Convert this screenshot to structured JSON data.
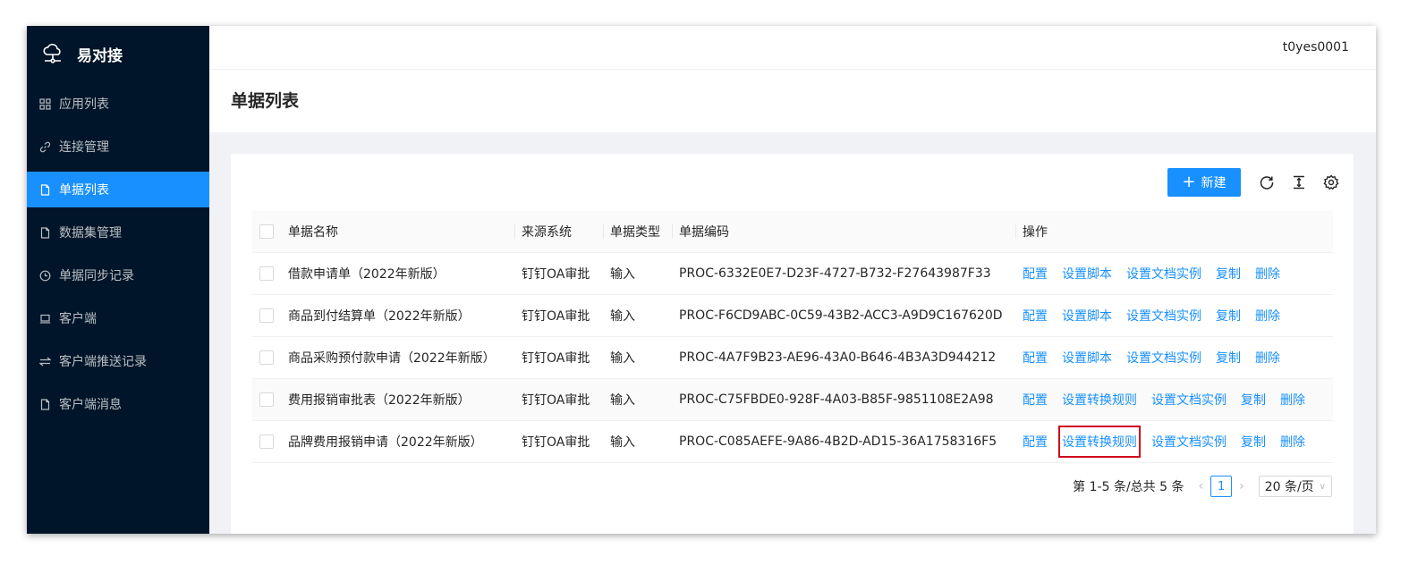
{
  "app": {
    "name": "易对接"
  },
  "user": {
    "name": "t0yes0001"
  },
  "sidebar": {
    "items": [
      {
        "label": "应用列表",
        "icon": "grid-icon"
      },
      {
        "label": "连接管理",
        "icon": "link-icon"
      },
      {
        "label": "单据列表",
        "icon": "file-icon",
        "active": true
      },
      {
        "label": "数据集管理",
        "icon": "file-icon"
      },
      {
        "label": "单据同步记录",
        "icon": "clock-icon"
      },
      {
        "label": "客户端",
        "icon": "laptop-icon"
      },
      {
        "label": "客户端推送记录",
        "icon": "swap-icon"
      },
      {
        "label": "客户端消息",
        "icon": "file-icon"
      }
    ]
  },
  "page": {
    "title": "单据列表"
  },
  "toolbar": {
    "new_label": "新建"
  },
  "table": {
    "columns": [
      "单据名称",
      "来源系统",
      "单据类型",
      "单据编码",
      "操作"
    ],
    "rows": [
      {
        "name": "借款申请单（2022年新版）",
        "source": "钉钉OA审批",
        "type": "输入",
        "code": "PROC-6332E0E7-D23F-4727-B732-F27643987F33",
        "actions": [
          "配置",
          "设置脚本",
          "设置文档实例",
          "复制",
          "删除"
        ]
      },
      {
        "name": "商品到付结算单（2022年新版）",
        "source": "钉钉OA审批",
        "type": "输入",
        "code": "PROC-F6CD9ABC-0C59-43B2-ACC3-A9D9C167620D",
        "actions": [
          "配置",
          "设置脚本",
          "设置文档实例",
          "复制",
          "删除"
        ]
      },
      {
        "name": "商品采购预付款申请（2022年新版）",
        "source": "钉钉OA审批",
        "type": "输入",
        "code": "PROC-4A7F9B23-AE96-43A0-B646-4B3A3D944212",
        "actions": [
          "配置",
          "设置脚本",
          "设置文档实例",
          "复制",
          "删除"
        ]
      },
      {
        "name": "费用报销审批表（2022年新版）",
        "source": "钉钉OA审批",
        "type": "输入",
        "code": "PROC-C75FBDE0-928F-4A03-B85F-9851108E2A98",
        "actions": [
          "配置",
          "设置转换规则",
          "设置文档实例",
          "复制",
          "删除"
        ]
      },
      {
        "name": "品牌费用报销申请（2022年新版）",
        "source": "钉钉OA审批",
        "type": "输入",
        "code": "PROC-C085AEFE-9A86-4B2D-AD15-36A1758316F5",
        "actions": [
          "配置",
          "设置转换规则",
          "设置文档实例",
          "复制",
          "删除"
        ]
      }
    ]
  },
  "pagination": {
    "summary": "第 1-5 条/总共 5 条",
    "current_page": "1",
    "page_size": "20 条/页"
  },
  "colors": {
    "sidebar_bg": "#001529",
    "primary": "#1890ff",
    "highlight_box": "#d0021b"
  }
}
